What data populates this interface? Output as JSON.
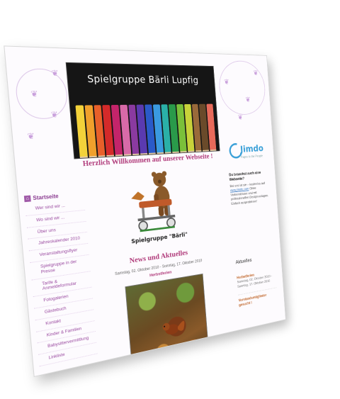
{
  "banner": {
    "title": "Spielgruppe Bärli Lupfig"
  },
  "main": {
    "welcome": "Herzlich Willkommen auf unserer Webseite !",
    "logo_caption": "Spielgruppe \"Bärli\"",
    "news_title": "News und Aktuelles",
    "news_date": "Samstag, 02. Oktober 2010 - Sonntag, 17. Oktober 2010",
    "news_subtitle": "Herbstferien"
  },
  "nav": {
    "home_label": "Startseite",
    "items": [
      "Wer sind wir ...",
      "Wo sind wir ...",
      "Über uns",
      "Jahreskalender 2010",
      "Veranstaltungsflyer",
      "Spielgruppe in der Presse",
      "Tarife & Anmeldeformular",
      "Fotogalerien",
      "Gästebuch",
      "Kontakt",
      "Kinder & Familien",
      "Babysittervermittlung",
      "Linkliste"
    ]
  },
  "sidebar": {
    "jimdo_logo": "Jimdo",
    "jimdo_tagline": "Pages to the People",
    "promo_title": "Du brauchst auch eine Webseite?",
    "promo_line1": "Bei uns ist sie – kostenlos auf",
    "promo_link": "www.jimdo.com",
    "promo_line2": "Ohne Vorkenntnisse und mit professionellen Designvorlagen. Einfach ausprobieren!",
    "aktuelles_title": "Aktuelles",
    "news_items": [
      {
        "title": "Herbstferien",
        "date": "Samstag, 02. Oktober 2010 - Sonntag, 17. Oktober 2010"
      },
      {
        "title": "Vorstandsmitglieder gesucht !",
        "date": ""
      }
    ]
  },
  "colors": {
    "accent": "#b03a7a",
    "nav": "#9a4aa0",
    "jimdo": "#3aa0d8"
  }
}
